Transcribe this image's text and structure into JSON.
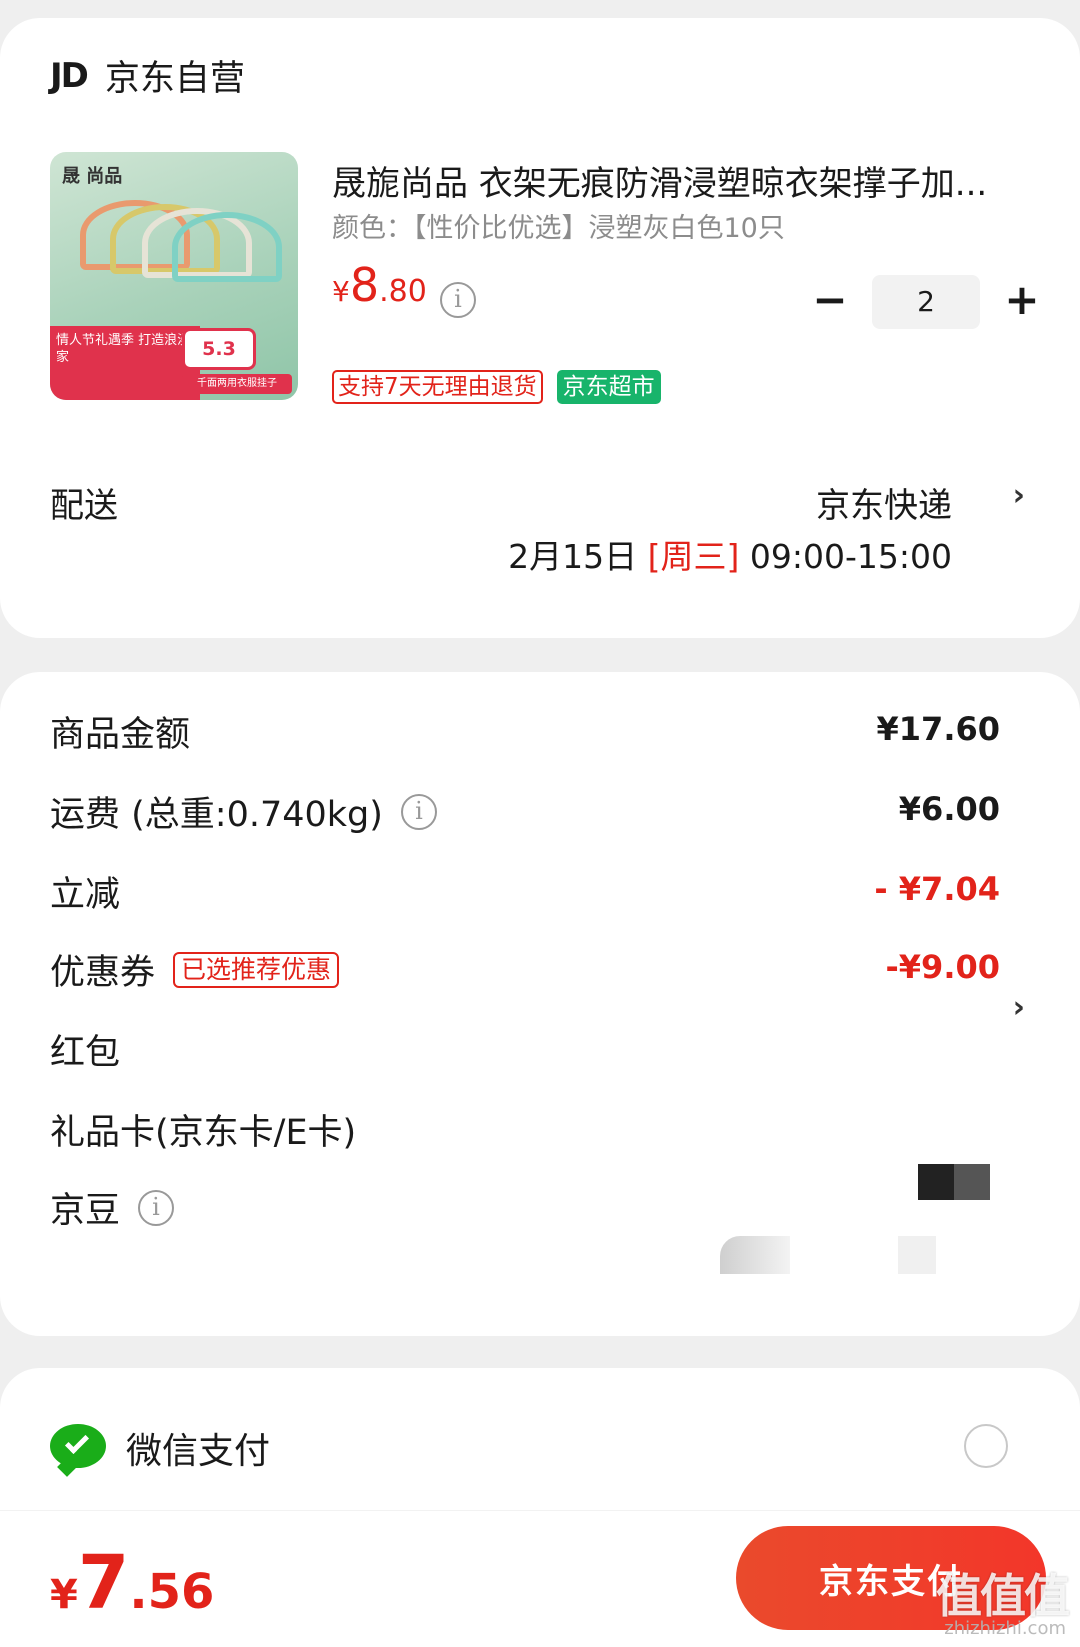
{
  "shop": {
    "logo": "JD",
    "name": "京东自营"
  },
  "product": {
    "title": "晟旎尚品 衣架无痕防滑浸塑晾衣架撑子加...",
    "spec": "颜色：【性价比优选】浸塑灰白色10只",
    "price_symbol": "¥",
    "price_int": "8",
    "price_dec": ".80",
    "quantity": "2",
    "minus": "−",
    "plus": "+",
    "tags": [
      "支持7天无理由退货",
      "京东超市"
    ],
    "image": {
      "brand": "晟 尚品",
      "promo_text": "情人节礼遇季 打造浪漫家",
      "promo_price": "5.3",
      "promo_bar": "千面两用衣服挂子"
    }
  },
  "delivery": {
    "label": "配送",
    "method": "京东快递",
    "date": "2月15日 ",
    "weekday": "[周三]",
    "time": " 09:00-15:00"
  },
  "summary": {
    "goods_label": "商品金额",
    "goods_value": "¥17.60",
    "shipping_label": "运费 (总重:0.740kg)",
    "shipping_value": "¥6.00",
    "discount_label": "立减",
    "discount_value": "- ¥7.04",
    "coupon_label": "优惠券",
    "coupon_tag": "已选推荐优惠",
    "coupon_value": "-¥9.00",
    "redpacket_label": "红包",
    "giftcard_label": "礼品卡(京东卡/E卡)",
    "jingdou_label": "京豆"
  },
  "payment": {
    "wechat_label": "微信支付",
    "total_symbol": "¥",
    "total_int": "7",
    "total_dec": ".56",
    "pay_button": "京东支付"
  },
  "watermark": {
    "main": "值值值",
    "sub": "zhizhizhi.com"
  },
  "icons": {
    "info": "i",
    "chevron": "›"
  },
  "colors": {
    "accent": "#e2231a",
    "green_tag": "#18b46b",
    "wechat": "#1aad19"
  }
}
